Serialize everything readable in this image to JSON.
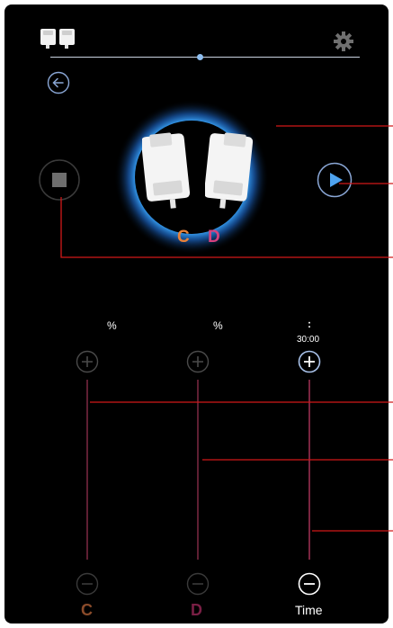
{
  "header": {
    "device_icon": "pads-icon",
    "settings_icon": "gear-icon",
    "slider_value": 0.5
  },
  "nav": {
    "back_icon": "arrow-left-icon"
  },
  "device": {
    "channel_c": "C",
    "channel_d": "D",
    "pad_icon": "electrode-pad-icon",
    "c_color": "#e8823a",
    "d_color": "#d6417e",
    "glow_color": "#3aa8ff"
  },
  "controls": {
    "stop_icon": "stop-icon",
    "play_icon": "play-icon"
  },
  "channels": [
    {
      "unit": "%",
      "value": "",
      "label": "C",
      "color": "#8a4b2a"
    },
    {
      "unit": "%",
      "value": "",
      "label": "D",
      "color": "#7a1f45"
    },
    {
      "unit": ":",
      "value": "30:00",
      "label": "Time",
      "color": "#ffffff"
    }
  ],
  "annotation_color": "#d11818"
}
